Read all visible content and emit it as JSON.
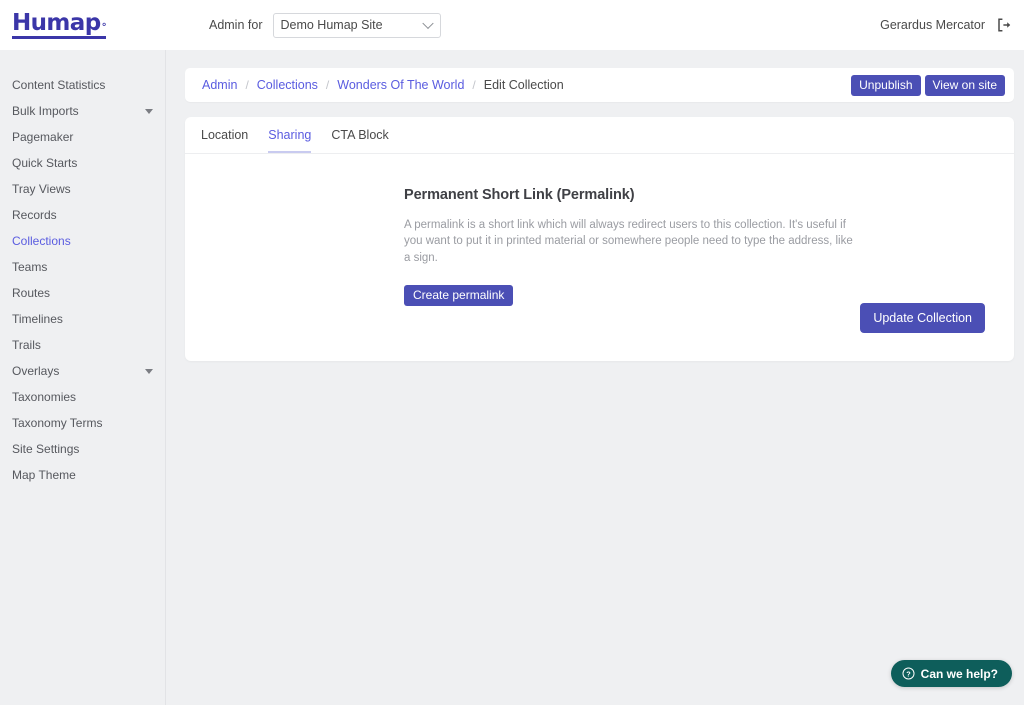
{
  "topbar": {
    "logo_text": "Humap",
    "logo_mark": "°",
    "admin_for_label": "Admin for",
    "site_select_value": "Demo Humap Site",
    "site_select_options": [
      "Demo Humap Site"
    ],
    "username": "Gerardus Mercator",
    "signout_icon": "sign-out-icon"
  },
  "sidebar": {
    "items": [
      {
        "label": "Content Statistics",
        "active": false,
        "expandable": false
      },
      {
        "label": "Bulk Imports",
        "active": false,
        "expandable": true
      },
      {
        "label": "Pagemaker",
        "active": false,
        "expandable": false
      },
      {
        "label": "Quick Starts",
        "active": false,
        "expandable": false
      },
      {
        "label": "Tray Views",
        "active": false,
        "expandable": false
      },
      {
        "label": "Records",
        "active": false,
        "expandable": false
      },
      {
        "label": "Collections",
        "active": true,
        "expandable": false
      },
      {
        "label": "Teams",
        "active": false,
        "expandable": false
      },
      {
        "label": "Routes",
        "active": false,
        "expandable": false
      },
      {
        "label": "Timelines",
        "active": false,
        "expandable": false
      },
      {
        "label": "Trails",
        "active": false,
        "expandable": false
      },
      {
        "label": "Overlays",
        "active": false,
        "expandable": true
      },
      {
        "label": "Taxonomies",
        "active": false,
        "expandable": false
      },
      {
        "label": "Taxonomy Terms",
        "active": false,
        "expandable": false
      },
      {
        "label": "Site Settings",
        "active": false,
        "expandable": false
      },
      {
        "label": "Map Theme",
        "active": false,
        "expandable": false
      }
    ]
  },
  "breadcrumb": {
    "items": [
      {
        "label": "Admin",
        "current": false
      },
      {
        "label": "Collections",
        "current": false
      },
      {
        "label": "Wonders Of The World",
        "current": false
      },
      {
        "label": "Edit Collection",
        "current": true
      }
    ],
    "separator": "/",
    "unpublish_label": "Unpublish",
    "view_on_site_label": "View on site"
  },
  "tabs": [
    {
      "label": "Location",
      "active": false
    },
    {
      "label": "Sharing",
      "active": true
    },
    {
      "label": "CTA Block",
      "active": false
    }
  ],
  "main": {
    "section_title": "Permanent Short Link (Permalink)",
    "section_description": "A permalink is a short link which will always redirect users to this collection. It's useful if you want to put it in printed material or somewhere people need to type the address, like a sign.",
    "create_permalink_label": "Create permalink",
    "update_collection_label": "Update Collection"
  },
  "help_widget": {
    "label": "Can we help?",
    "icon": "question-circle-icon"
  },
  "colors": {
    "brand_indigo": "#4b4fb5",
    "logo_indigo": "#3b36a8",
    "link_indigo": "#5a5ce0",
    "tab_underline": "#c9cbf0",
    "page_bg": "#eff0f2",
    "panel_bg": "#ffffff",
    "help_teal": "#0e5e5b"
  }
}
